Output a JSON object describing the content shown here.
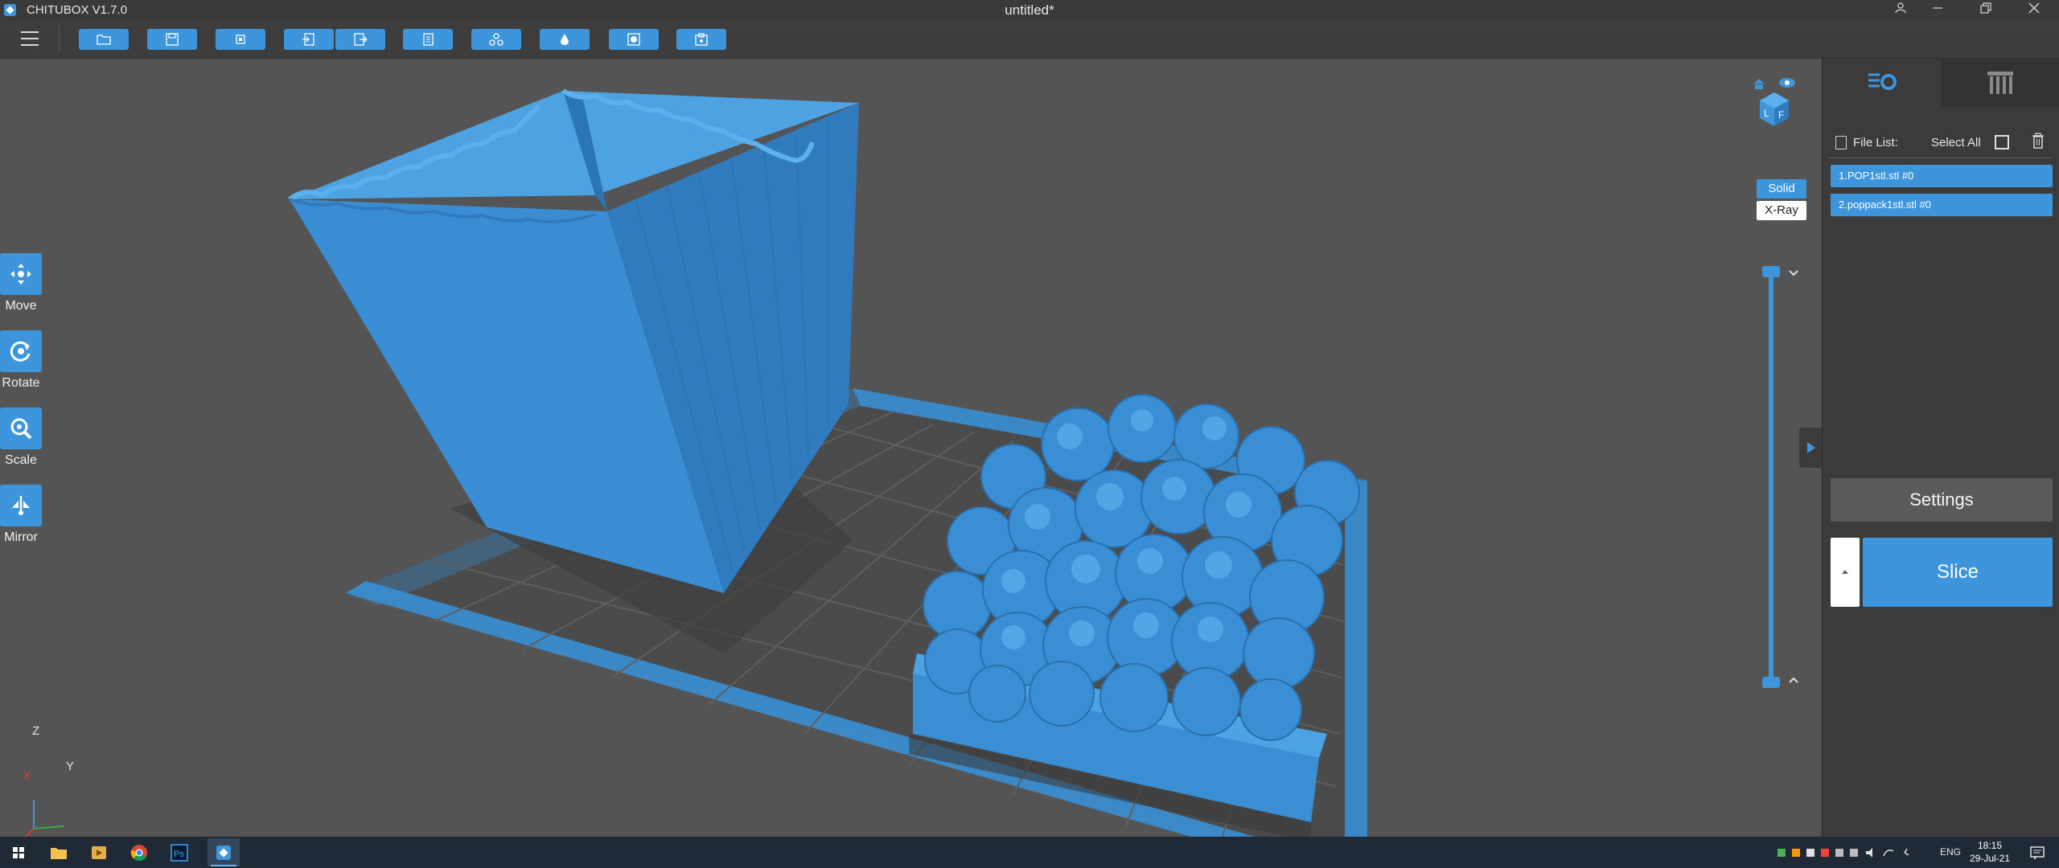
{
  "window": {
    "app_name": "CHITUBOX V1.7.0",
    "title": "untitled*"
  },
  "toolbar": {
    "buttons": [
      "open-file-icon",
      "save-file-icon",
      "fit-view-icon",
      "import-icon",
      "export-icon",
      "copy-icon",
      "layout-icon",
      "support-icon",
      "hollow-icon",
      "dig-hole-icon"
    ]
  },
  "tools": {
    "move": "Move",
    "rotate": "Rotate",
    "scale": "Scale",
    "mirror": "Mirror"
  },
  "view_mode": {
    "solid": "Solid",
    "xray": "X-Ray"
  },
  "axes": {
    "z": "Z",
    "y": "Y",
    "x": "X"
  },
  "panel": {
    "file_list_label": "File List:",
    "select_all_label": "Select All",
    "files": [
      "1.POP1stl.stl #0",
      "2.poppack1stl.stl #0"
    ],
    "settings_label": "Settings",
    "slice_label": "Slice"
  },
  "taskbar": {
    "language": "ENG",
    "time": "18:15",
    "date": "29-Jul-21"
  },
  "colors": {
    "accent": "#3d96dc",
    "viewport_bg": "#545454",
    "model": "#3a8fd4"
  }
}
